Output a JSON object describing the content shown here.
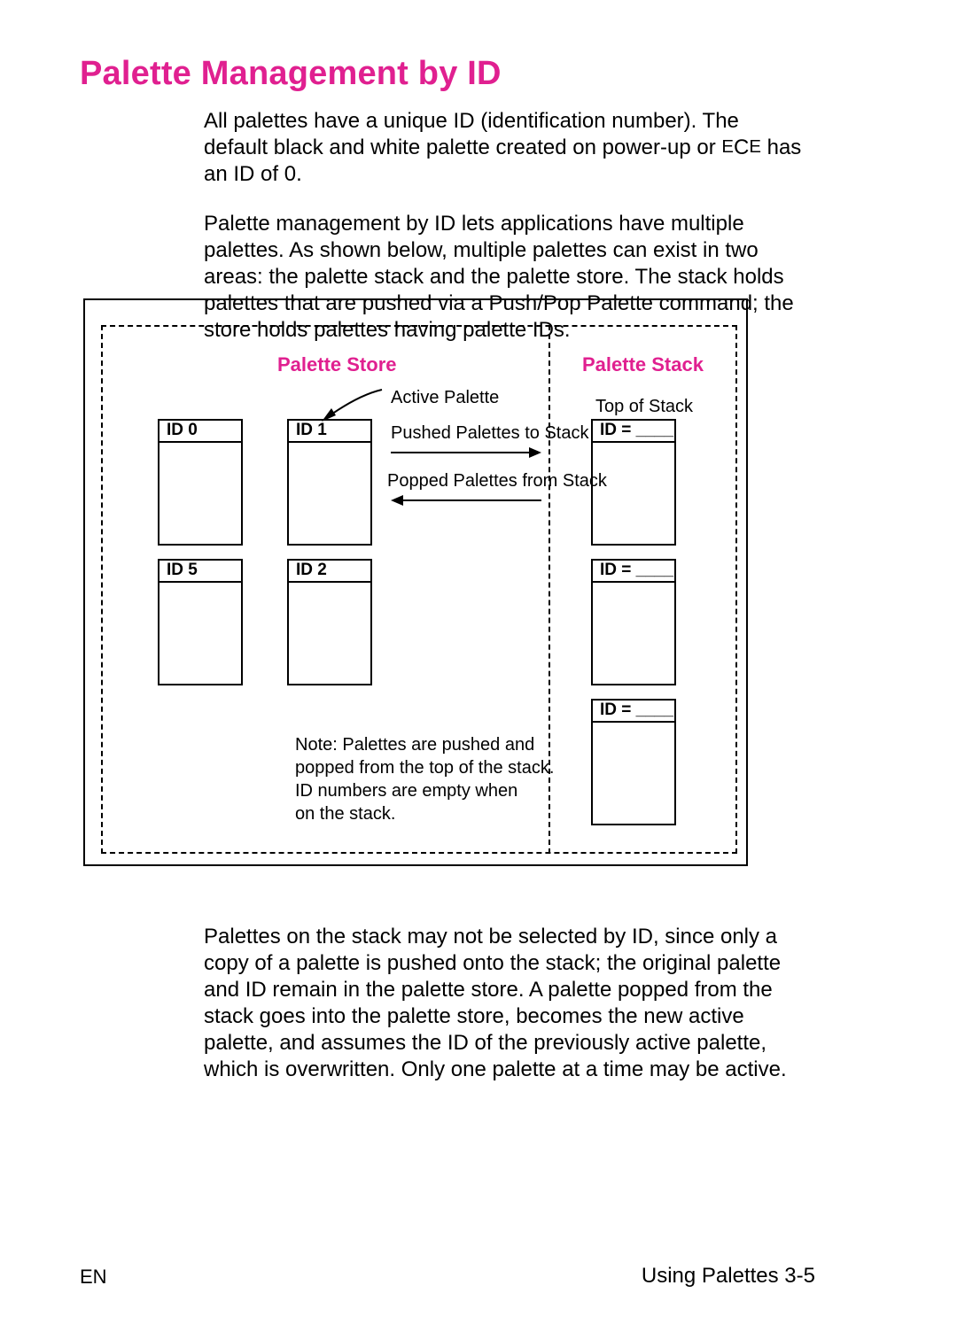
{
  "heading": "Palette Management by ID",
  "p1_a": "All palettes have a unique ID (identification number). The default black and white palette created on power-up or ",
  "p1_ece_E1": "E",
  "p1_ece_c": "C",
  "p1_ece_E2": "E",
  "p1_b": " has an ID of 0.",
  "p2": "Palette management by ID lets applications have multiple palettes. As shown below, multiple palettes can exist in two areas: the palette stack and the palette store. The stack holds palettes that are pushed via a Push/Pop Palette command; the store holds palettes having palette IDs.",
  "diagram": {
    "store_title": "Palette Store",
    "stack_title": "Palette Stack",
    "active_palette": "Active Palette",
    "top_of_stack": "Top of Stack",
    "pushed": "Pushed Palettes to Stack",
    "popped": "Popped Palettes from Stack",
    "note1": "Note: Palettes are pushed and",
    "note2": "popped from the top of the stack.",
    "note3": "ID numbers are empty when",
    "note4": "on the stack.",
    "boxes": {
      "id0": "ID 0",
      "id1": "ID 1",
      "id5": "ID 5",
      "id2": "ID 2",
      "eq1": "ID = ____",
      "eq2": "ID = ____",
      "eq3": "ID = ____"
    }
  },
  "p3": "Palettes on the stack may not be selected by ID, since only a copy of a palette is pushed onto the stack; the original palette and ID remain in the palette store. A palette popped from the stack goes into the palette store, becomes the new active palette, and assumes the ID of the previously active palette, which is overwritten. Only one palette at a time may be active.",
  "footer_left": "EN",
  "footer_right": "Using Palettes  3-5"
}
